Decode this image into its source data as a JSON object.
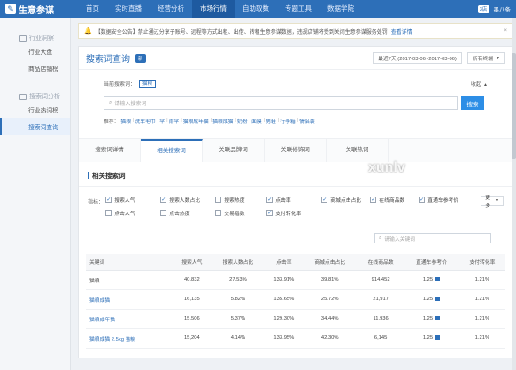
{
  "app": {
    "logo_text": "生意参谋"
  },
  "topnav": {
    "items": [
      "首页",
      "实时直播",
      "经营分析",
      "市场行情",
      "自助取数",
      "专题工具",
      "数据学院"
    ],
    "active_index": 3,
    "user_badge": "3店",
    "user_name": "墨八条"
  },
  "sidebar": {
    "groups": [
      {
        "title": "行业洞察",
        "items": [
          "行业大盘",
          "商品店铺榜"
        ]
      },
      {
        "title": "搜索词分析",
        "items": [
          "行业热词榜",
          "搜索词查询"
        ]
      }
    ],
    "active_item": "搜索词查询"
  },
  "notice": {
    "text": "【数据安全公告】禁止通过分享子账号、远程等方式出租、出借、转租生意参谋数据，违规店铺将受到关闭生意参谋服务处罚",
    "link": "查看详情",
    "close": "×"
  },
  "panel": {
    "title": "搜索词查询",
    "tag": "新",
    "date_range": "最近7天 (2017-03-06~2017-03-06)",
    "device": "所有终端",
    "scope_label": "当前搜索词：",
    "scope_value": "猫粮",
    "collapse": "收起"
  },
  "search": {
    "placeholder": "请输入搜索词",
    "button": "搜索"
  },
  "recommend": {
    "label": "推荐：",
    "items": [
      "猫粮",
      "洗车毛巾",
      "伞",
      "雨伞",
      "猫粮成年猫",
      "猫粮成猫",
      "奶粉",
      "面膜",
      "男鞋",
      "行李箱",
      "情侣装"
    ]
  },
  "tabs": {
    "items": [
      "搜索词详情",
      "相关搜索词",
      "关联品牌词",
      "关联修饰词",
      "关联热词"
    ],
    "active_index": 1
  },
  "section": {
    "title": "相关搜索词"
  },
  "indicators": {
    "label": "指标：",
    "items": [
      {
        "name": "搜索人气",
        "checked": true
      },
      {
        "name": "搜索人数占比",
        "checked": true
      },
      {
        "name": "搜索热度",
        "checked": false
      },
      {
        "name": "点击率",
        "checked": true
      },
      {
        "name": "商城点击占比",
        "checked": true
      },
      {
        "name": "在线商品数",
        "checked": true
      },
      {
        "name": "直通车参考价",
        "checked": true
      },
      {
        "name": "点击人气",
        "checked": false
      },
      {
        "name": "点击热度",
        "checked": false
      },
      {
        "name": "交易指数",
        "checked": false
      },
      {
        "name": "支付转化率",
        "checked": true
      }
    ],
    "more": "更多"
  },
  "filter": {
    "placeholder": "请输入关键词"
  },
  "table": {
    "columns": [
      "关键词",
      "搜索人气",
      "搜索人数占比",
      "点击率",
      "商城点击占比",
      "在线商品数",
      "直通车参考价",
      "支付转化率"
    ],
    "rows": [
      [
        "猫粮",
        "40,832",
        "27.53%",
        "133.91%",
        "39.81%",
        "914,452",
        "1.25",
        "1.21%"
      ],
      [
        "猫粮成猫",
        "16,135",
        "5.82%",
        "135.65%",
        "25.72%",
        "21,917",
        "1.25",
        "1.21%"
      ],
      [
        "猫粮成年猫",
        "15,506",
        "5.37%",
        "129.30%",
        "34.44%",
        "11,936",
        "1.25",
        "1.21%"
      ],
      [
        "猫粮成猫 2.5kg",
        "15,204",
        "4.14%",
        "133.95%",
        "42.30%",
        "6,145",
        "1.25",
        "1.21%"
      ]
    ],
    "row_sub": [
      "",
      "",
      "",
      "猫粮"
    ]
  },
  "watermark": "xunlv"
}
